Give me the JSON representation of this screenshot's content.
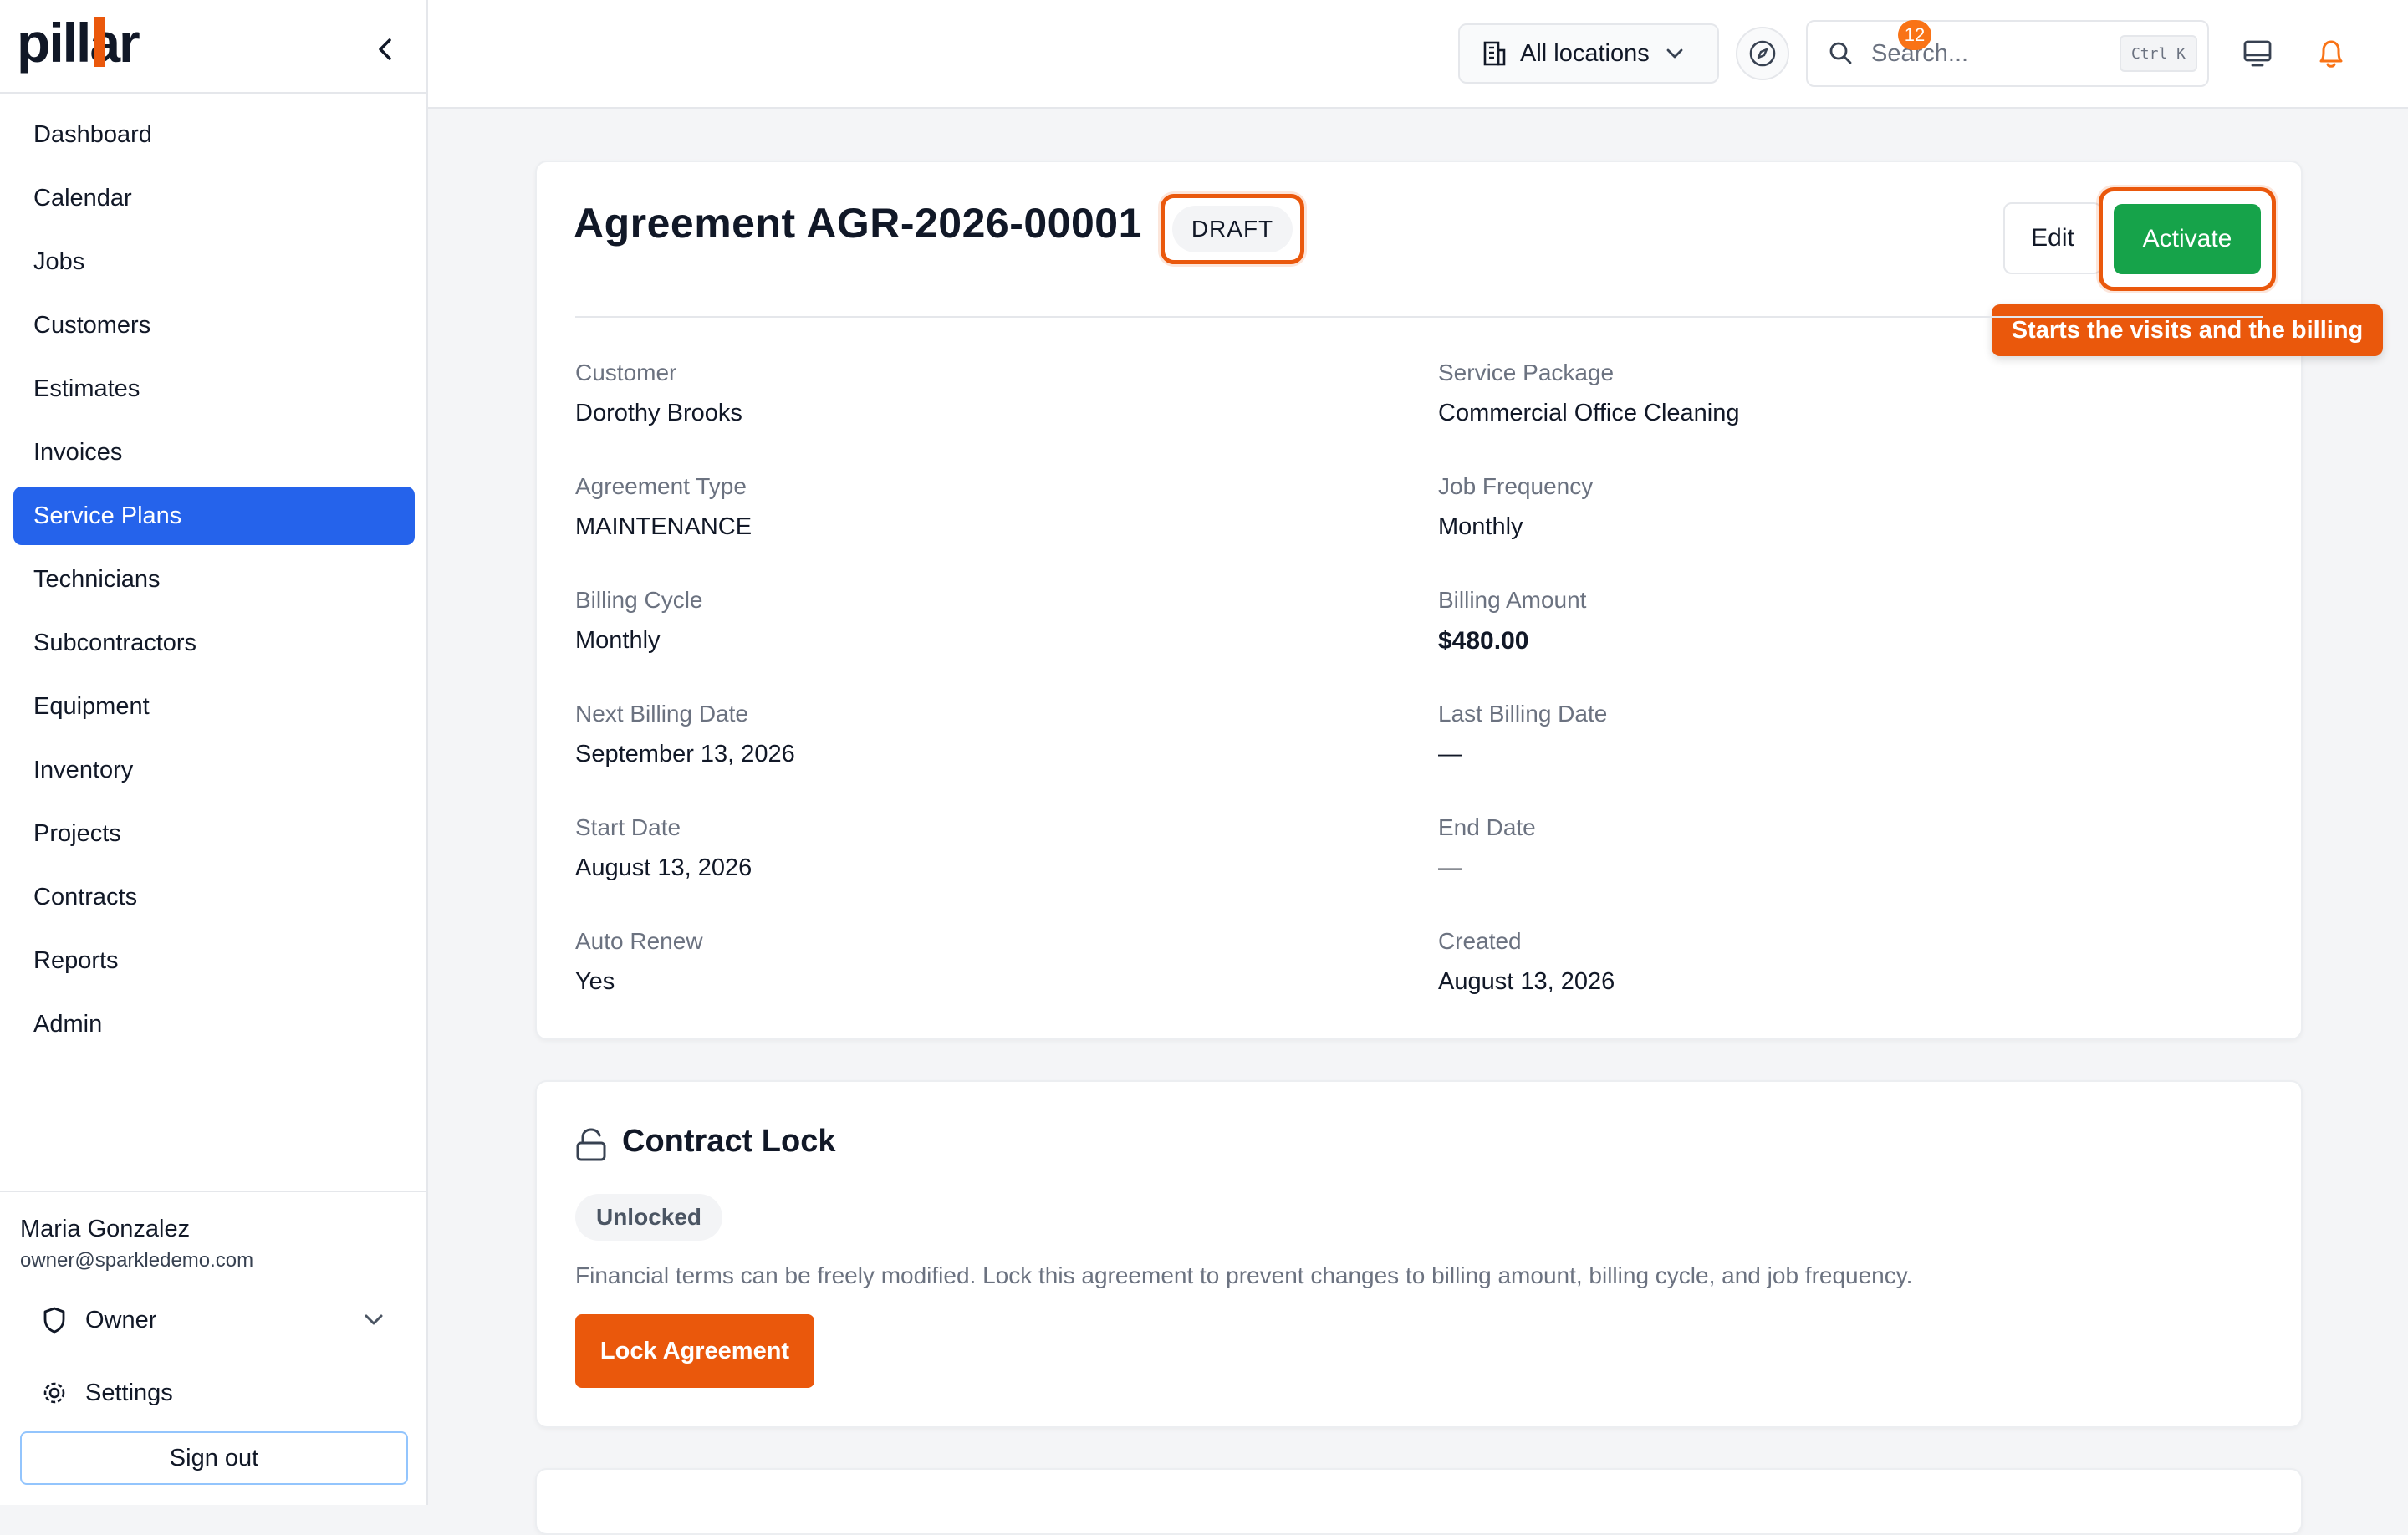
{
  "app": {
    "brand": "pillar"
  },
  "colors": {
    "primary": "#2563eb",
    "success": "#16a34a",
    "accent": "#ea580c",
    "notification": "#f97316"
  },
  "sidebar": {
    "collapse_icon": "chevron-left-icon",
    "items": [
      {
        "label": "Dashboard"
      },
      {
        "label": "Calendar"
      },
      {
        "label": "Jobs"
      },
      {
        "label": "Customers"
      },
      {
        "label": "Estimates"
      },
      {
        "label": "Invoices"
      },
      {
        "label": "Service Plans",
        "active": true
      },
      {
        "label": "Technicians"
      },
      {
        "label": "Subcontractors"
      },
      {
        "label": "Equipment"
      },
      {
        "label": "Inventory"
      },
      {
        "label": "Projects"
      },
      {
        "label": "Contracts"
      },
      {
        "label": "Reports"
      },
      {
        "label": "Admin"
      }
    ],
    "user": {
      "name": "Maria Gonzalez",
      "email": "owner@sparkledemo.com"
    },
    "role": {
      "label": "Owner",
      "icon": "shield-icon"
    },
    "settings": {
      "label": "Settings",
      "icon": "gear-icon"
    },
    "sign_out": "Sign out"
  },
  "topbar": {
    "location_select": {
      "value": "All locations",
      "icon": "building-icon"
    },
    "compass_icon": "compass-icon",
    "search": {
      "placeholder": "Search...",
      "shortcut": "Ctrl K"
    },
    "monitor_icon": "monitor-icon",
    "notifications": {
      "icon": "bell-icon",
      "count": "12"
    }
  },
  "agreement": {
    "title": "Agreement AGR-2026-00001",
    "status": "DRAFT",
    "edit_label": "Edit",
    "activate_label": "Activate",
    "callout": "Starts the visits and the billing",
    "fields_left": [
      {
        "label": "Customer",
        "value": "Dorothy Brooks"
      },
      {
        "label": "Agreement Type",
        "value": "MAINTENANCE"
      },
      {
        "label": "Billing Cycle",
        "value": "Monthly"
      },
      {
        "label": "Next Billing Date",
        "value": "September 13, 2026"
      },
      {
        "label": "Start Date",
        "value": "August 13, 2026"
      },
      {
        "label": "Auto Renew",
        "value": "Yes"
      }
    ],
    "fields_right": [
      {
        "label": "Service Package",
        "value": "Commercial Office Cleaning"
      },
      {
        "label": "Job Frequency",
        "value": "Monthly"
      },
      {
        "label": "Billing Amount",
        "value": "$480.00"
      },
      {
        "label": "Last Billing Date",
        "value": "—"
      },
      {
        "label": "End Date",
        "value": "—"
      },
      {
        "label": "Created",
        "value": "August 13, 2026"
      }
    ]
  },
  "contract_lock": {
    "title": "Contract Lock",
    "icon": "unlock-icon",
    "status": "Unlocked",
    "description": "Financial terms can be freely modified. Lock this agreement to prevent changes to billing amount, billing cycle, and job frequency.",
    "button": "Lock Agreement"
  }
}
